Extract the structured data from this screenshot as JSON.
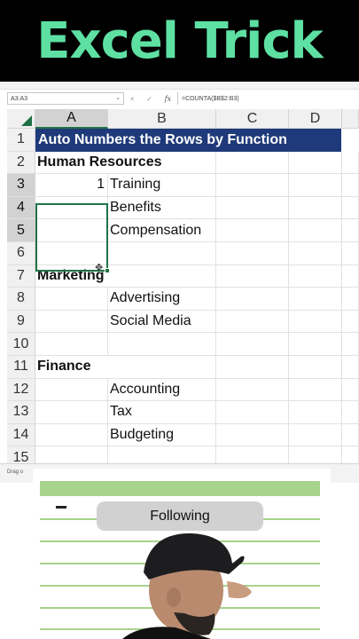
{
  "banner": {
    "title": "Excel Trick"
  },
  "formula_bar": {
    "name_box": "A3:A3",
    "cancel_icon": "×",
    "enter_icon": "✓",
    "fx_label": "fx",
    "formula": "=COUNTA($B$2:B3)"
  },
  "columns": [
    "A",
    "B",
    "C",
    "D"
  ],
  "rows": [
    {
      "num": "1",
      "a": "Auto Numbers the Rows by Function",
      "b": "",
      "title": true
    },
    {
      "num": "2",
      "a": "Human Resources",
      "b": "",
      "bold": true
    },
    {
      "num": "3",
      "a": "1",
      "b": "Training"
    },
    {
      "num": "4",
      "a": "",
      "b": "Benefits"
    },
    {
      "num": "5",
      "a": "",
      "b": "Compensation"
    },
    {
      "num": "6",
      "a": "",
      "b": ""
    },
    {
      "num": "7",
      "a": "Marketing",
      "b": "",
      "bold": true
    },
    {
      "num": "8",
      "a": "",
      "b": "Advertising"
    },
    {
      "num": "9",
      "a": "",
      "b": "Social Media"
    },
    {
      "num": "10",
      "a": "",
      "b": ""
    },
    {
      "num": "11",
      "a": "Finance",
      "b": "",
      "bold": true
    },
    {
      "num": "12",
      "a": "",
      "b": "Accounting"
    },
    {
      "num": "13",
      "a": "",
      "b": "Tax"
    },
    {
      "num": "14",
      "a": "",
      "b": "Budgeting"
    },
    {
      "num": "15",
      "a": "",
      "b": ""
    }
  ],
  "status_bar": {
    "text": "Drag o"
  },
  "follow_button": {
    "label": "Following"
  },
  "colors": {
    "banner_text": "#5ee0a3",
    "title_fill": "#1f3a7a",
    "excel_green": "#217346",
    "overlay_green": "#a7d38d"
  },
  "icons": {
    "select_all": "select-all-triangle-icon",
    "fill_handle": "fill-handle-cursor-icon",
    "name_box_dropdown": "chevron-down-icon"
  }
}
